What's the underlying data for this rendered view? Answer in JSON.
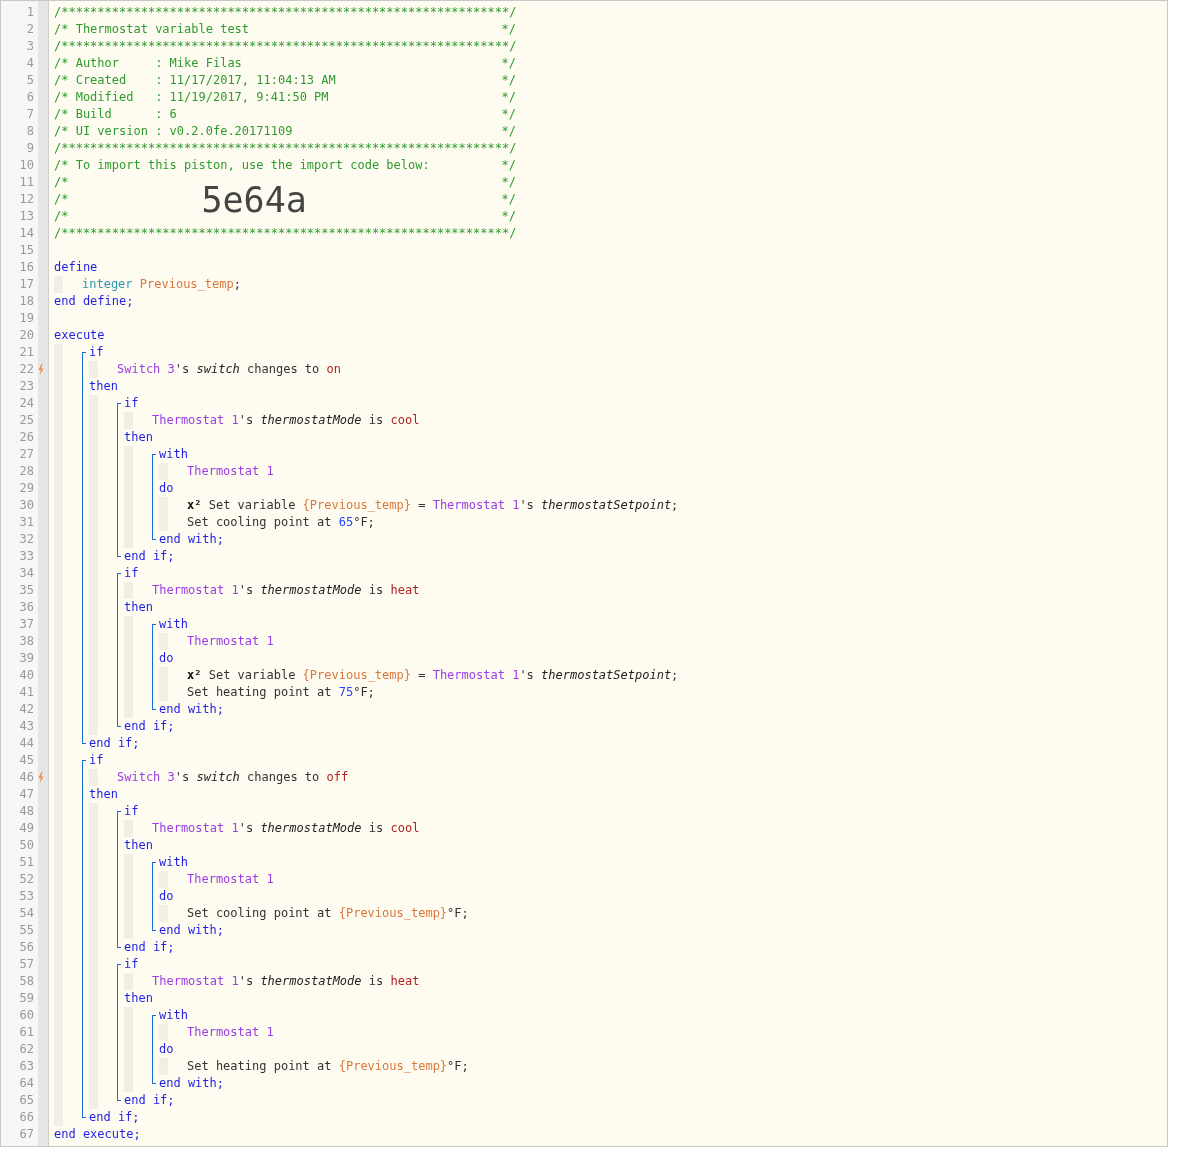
{
  "editor": {
    "lines": [
      {
        "n": "1",
        "trigger": false,
        "segments": [
          {
            "kind": "comment",
            "text": "/**************************************************************/"
          }
        ]
      },
      {
        "n": "2",
        "trigger": false,
        "segments": [
          {
            "kind": "comment",
            "text": "/* Thermostat variable test"
          },
          {
            "kind": "comment_end",
            "text": "*/"
          }
        ]
      },
      {
        "n": "3",
        "trigger": false,
        "segments": [
          {
            "kind": "comment",
            "text": "/**************************************************************/"
          }
        ]
      },
      {
        "n": "4",
        "trigger": false,
        "segments": [
          {
            "kind": "comment",
            "text": "/* Author     : Mike Filas"
          },
          {
            "kind": "comment_end",
            "text": "*/"
          }
        ]
      },
      {
        "n": "5",
        "trigger": false,
        "segments": [
          {
            "kind": "comment",
            "text": "/* Created    : 11/17/2017, 11:04:13 AM"
          },
          {
            "kind": "comment_end",
            "text": "*/"
          }
        ]
      },
      {
        "n": "6",
        "trigger": false,
        "segments": [
          {
            "kind": "comment",
            "text": "/* Modified   : 11/19/2017, 9:41:50 PM"
          },
          {
            "kind": "comment_end",
            "text": "*/"
          }
        ]
      },
      {
        "n": "7",
        "trigger": false,
        "segments": [
          {
            "kind": "comment",
            "text": "/* Build      : 6"
          },
          {
            "kind": "comment_end",
            "text": "*/"
          }
        ]
      },
      {
        "n": "8",
        "trigger": false,
        "segments": [
          {
            "kind": "comment",
            "text": "/* UI version : v0.2.0fe.20171109"
          },
          {
            "kind": "comment_end",
            "text": "*/"
          }
        ]
      },
      {
        "n": "9",
        "trigger": false,
        "segments": [
          {
            "kind": "comment",
            "text": "/**************************************************************/"
          }
        ]
      },
      {
        "n": "10",
        "trigger": false,
        "segments": [
          {
            "kind": "comment",
            "text": "/* To import this piston, use the import code below:"
          },
          {
            "kind": "comment_end",
            "text": "*/"
          }
        ]
      },
      {
        "n": "11",
        "trigger": false,
        "segments": [
          {
            "kind": "comment",
            "text": "/*"
          },
          {
            "kind": "comment_end",
            "text": "*/"
          }
        ]
      },
      {
        "n": "12",
        "trigger": false,
        "segments": [
          {
            "kind": "comment",
            "text": "/*"
          },
          {
            "kind": "import_code",
            "text": "5e64a"
          },
          {
            "kind": "comment_end",
            "text": "*/"
          }
        ]
      },
      {
        "n": "13",
        "trigger": false,
        "segments": [
          {
            "kind": "comment",
            "text": "/*"
          },
          {
            "kind": "comment_end",
            "text": "*/"
          }
        ]
      },
      {
        "n": "14",
        "trigger": false,
        "segments": [
          {
            "kind": "comment",
            "text": "/**************************************************************/"
          }
        ]
      },
      {
        "n": "15",
        "trigger": false
      },
      {
        "n": "16",
        "trigger": false,
        "segments": [
          {
            "kind": "keyword",
            "text": "define"
          }
        ]
      },
      {
        "kind": "indent",
        "children": [
          {
            "n": "17",
            "trigger": false,
            "segments": [
              {
                "kind": "type",
                "text": "integer"
              },
              {
                "kind": "variable",
                "text": "Previous_temp"
              },
              {
                "kind": "plain",
                "text": ";"
              }
            ]
          }
        ]
      },
      {
        "n": "18",
        "trigger": false,
        "segments": [
          {
            "kind": "keyword",
            "text": "end define;"
          }
        ]
      },
      {
        "n": "19",
        "trigger": false
      },
      {
        "n": "20",
        "trigger": false,
        "segments": [
          {
            "kind": "keyword",
            "text": "execute"
          }
        ]
      },
      {
        "kind": "indent",
        "children": [
          {
            "kind": "bracket",
            "children": [
              {
                "n": "21",
                "trigger": false,
                "segments": [
                  {
                    "kind": "keyword",
                    "text": "if"
                  }
                ]
              },
              {
                "kind": "indent",
                "children": [
                  {
                    "n": "22",
                    "trigger": true,
                    "segments": [
                      {
                        "kind": "device",
                        "text": "Switch 3"
                      },
                      {
                        "kind": "plain",
                        "text": "'s "
                      },
                      {
                        "kind": "attribute",
                        "text": "switch"
                      },
                      {
                        "kind": "plain",
                        "text": " changes to "
                      },
                      {
                        "kind": "value",
                        "text": "on"
                      }
                    ]
                  }
                ]
              },
              {
                "n": "23",
                "trigger": false,
                "segments": [
                  {
                    "kind": "keyword",
                    "text": "then"
                  }
                ]
              },
              {
                "kind": "indent",
                "children": [
                  {
                    "kind": "bracket",
                    "children": [
                      {
                        "n": "24",
                        "trigger": false,
                        "segments": [
                          {
                            "kind": "keyword",
                            "text": "if"
                          }
                        ]
                      },
                      {
                        "kind": "indent",
                        "children": [
                          {
                            "n": "25",
                            "trigger": false,
                            "segments": [
                              {
                                "kind": "device",
                                "text": "Thermostat 1"
                              },
                              {
                                "kind": "plain",
                                "text": "'s "
                              },
                              {
                                "kind": "attribute",
                                "text": "thermostatMode"
                              },
                              {
                                "kind": "plain",
                                "text": " is "
                              },
                              {
                                "kind": "value",
                                "text": "cool"
                              }
                            ]
                          }
                        ]
                      },
                      {
                        "n": "26",
                        "trigger": false,
                        "segments": [
                          {
                            "kind": "keyword",
                            "text": "then"
                          }
                        ]
                      },
                      {
                        "kind": "indent",
                        "children": [
                          {
                            "kind": "bracket",
                            "children": [
                              {
                                "n": "27",
                                "trigger": false,
                                "segments": [
                                  {
                                    "kind": "keyword",
                                    "text": "with"
                                  }
                                ]
                              },
                              {
                                "kind": "indent",
                                "children": [
                                  {
                                    "n": "28",
                                    "trigger": false,
                                    "segments": [
                                      {
                                        "kind": "device",
                                        "text": "Thermostat 1"
                                      }
                                    ]
                                  }
                                ]
                              },
                              {
                                "n": "29",
                                "trigger": false,
                                "segments": [
                                  {
                                    "kind": "keyword",
                                    "text": "do"
                                  }
                                ]
                              },
                              {
                                "kind": "indent",
                                "children": [
                                  {
                                    "n": "30",
                                    "trigger": false,
                                    "segments": [
                                      {
                                        "kind": "symbol",
                                        "text": "x²"
                                      },
                                      {
                                        "kind": "plain",
                                        "text": " Set variable "
                                      },
                                      {
                                        "kind": "variable",
                                        "text": "{Previous_temp}"
                                      },
                                      {
                                        "kind": "plain",
                                        "text": " = "
                                      },
                                      {
                                        "kind": "device",
                                        "text": "Thermostat 1"
                                      },
                                      {
                                        "kind": "plain",
                                        "text": "'s "
                                      },
                                      {
                                        "kind": "attribute",
                                        "text": "thermostatSetpoint"
                                      },
                                      {
                                        "kind": "plain",
                                        "text": ";"
                                      }
                                    ]
                                  },
                                  {
                                    "n": "31",
                                    "trigger": false,
                                    "segments": [
                                      {
                                        "kind": "plain",
                                        "text": "Set cooling point at "
                                      },
                                      {
                                        "kind": "number",
                                        "text": "65"
                                      },
                                      {
                                        "kind": "plain",
                                        "text": "°F;"
                                      }
                                    ]
                                  }
                                ]
                              },
                              {
                                "n": "32",
                                "trigger": false,
                                "segments": [
                                  {
                                    "kind": "keyword",
                                    "text": "end with;"
                                  }
                                ]
                              }
                            ]
                          }
                        ]
                      },
                      {
                        "n": "33",
                        "trigger": false,
                        "segments": [
                          {
                            "kind": "keyword",
                            "text": "end if;"
                          }
                        ]
                      }
                    ]
                  },
                  {
                    "kind": "bracket",
                    "children": [
                      {
                        "n": "34",
                        "trigger": false,
                        "segments": [
                          {
                            "kind": "keyword",
                            "text": "if"
                          }
                        ]
                      },
                      {
                        "kind": "indent",
                        "children": [
                          {
                            "n": "35",
                            "trigger": false,
                            "segments": [
                              {
                                "kind": "device",
                                "text": "Thermostat 1"
                              },
                              {
                                "kind": "plain",
                                "text": "'s "
                              },
                              {
                                "kind": "attribute",
                                "text": "thermostatMode"
                              },
                              {
                                "kind": "plain",
                                "text": " is "
                              },
                              {
                                "kind": "value",
                                "text": "heat"
                              }
                            ]
                          }
                        ]
                      },
                      {
                        "n": "36",
                        "trigger": false,
                        "segments": [
                          {
                            "kind": "keyword",
                            "text": "then"
                          }
                        ]
                      },
                      {
                        "kind": "indent",
                        "children": [
                          {
                            "kind": "bracket",
                            "children": [
                              {
                                "n": "37",
                                "trigger": false,
                                "segments": [
                                  {
                                    "kind": "keyword",
                                    "text": "with"
                                  }
                                ]
                              },
                              {
                                "kind": "indent",
                                "children": [
                                  {
                                    "n": "38",
                                    "trigger": false,
                                    "segments": [
                                      {
                                        "kind": "device",
                                        "text": "Thermostat 1"
                                      }
                                    ]
                                  }
                                ]
                              },
                              {
                                "n": "39",
                                "trigger": false,
                                "segments": [
                                  {
                                    "kind": "keyword",
                                    "text": "do"
                                  }
                                ]
                              },
                              {
                                "kind": "indent",
                                "children": [
                                  {
                                    "n": "40",
                                    "trigger": false,
                                    "segments": [
                                      {
                                        "kind": "symbol",
                                        "text": "x²"
                                      },
                                      {
                                        "kind": "plain",
                                        "text": " Set variable "
                                      },
                                      {
                                        "kind": "variable",
                                        "text": "{Previous_temp}"
                                      },
                                      {
                                        "kind": "plain",
                                        "text": " = "
                                      },
                                      {
                                        "kind": "device",
                                        "text": "Thermostat 1"
                                      },
                                      {
                                        "kind": "plain",
                                        "text": "'s "
                                      },
                                      {
                                        "kind": "attribute",
                                        "text": "thermostatSetpoint"
                                      },
                                      {
                                        "kind": "plain",
                                        "text": ";"
                                      }
                                    ]
                                  },
                                  {
                                    "n": "41",
                                    "trigger": false,
                                    "segments": [
                                      {
                                        "kind": "plain",
                                        "text": "Set heating point at "
                                      },
                                      {
                                        "kind": "number",
                                        "text": "75"
                                      },
                                      {
                                        "kind": "plain",
                                        "text": "°F;"
                                      }
                                    ]
                                  }
                                ]
                              },
                              {
                                "n": "42",
                                "trigger": false,
                                "segments": [
                                  {
                                    "kind": "keyword",
                                    "text": "end with;"
                                  }
                                ]
                              }
                            ]
                          }
                        ]
                      },
                      {
                        "n": "43",
                        "trigger": false,
                        "segments": [
                          {
                            "kind": "keyword",
                            "text": "end if;"
                          }
                        ]
                      }
                    ]
                  }
                ]
              },
              {
                "n": "44",
                "trigger": false,
                "segments": [
                  {
                    "kind": "keyword",
                    "text": "end if;"
                  }
                ]
              }
            ]
          },
          {
            "kind": "bracket",
            "children": [
              {
                "n": "45",
                "trigger": false,
                "segments": [
                  {
                    "kind": "keyword",
                    "text": "if"
                  }
                ]
              },
              {
                "kind": "indent",
                "children": [
                  {
                    "n": "46",
                    "trigger": true,
                    "segments": [
                      {
                        "kind": "device",
                        "text": "Switch 3"
                      },
                      {
                        "kind": "plain",
                        "text": "'s "
                      },
                      {
                        "kind": "attribute",
                        "text": "switch"
                      },
                      {
                        "kind": "plain",
                        "text": " changes to "
                      },
                      {
                        "kind": "value",
                        "text": "off"
                      }
                    ]
                  }
                ]
              },
              {
                "n": "47",
                "trigger": false,
                "segments": [
                  {
                    "kind": "keyword",
                    "text": "then"
                  }
                ]
              },
              {
                "kind": "indent",
                "children": [
                  {
                    "kind": "bracket",
                    "children": [
                      {
                        "n": "48",
                        "trigger": false,
                        "segments": [
                          {
                            "kind": "keyword",
                            "text": "if"
                          }
                        ]
                      },
                      {
                        "kind": "indent",
                        "children": [
                          {
                            "n": "49",
                            "trigger": false,
                            "segments": [
                              {
                                "kind": "device",
                                "text": "Thermostat 1"
                              },
                              {
                                "kind": "plain",
                                "text": "'s "
                              },
                              {
                                "kind": "attribute",
                                "text": "thermostatMode"
                              },
                              {
                                "kind": "plain",
                                "text": " is "
                              },
                              {
                                "kind": "value",
                                "text": "cool"
                              }
                            ]
                          }
                        ]
                      },
                      {
                        "n": "50",
                        "trigger": false,
                        "segments": [
                          {
                            "kind": "keyword",
                            "text": "then"
                          }
                        ]
                      },
                      {
                        "kind": "indent",
                        "children": [
                          {
                            "kind": "bracket",
                            "children": [
                              {
                                "n": "51",
                                "trigger": false,
                                "segments": [
                                  {
                                    "kind": "keyword",
                                    "text": "with"
                                  }
                                ]
                              },
                              {
                                "kind": "indent",
                                "children": [
                                  {
                                    "n": "52",
                                    "trigger": false,
                                    "segments": [
                                      {
                                        "kind": "device",
                                        "text": "Thermostat 1"
                                      }
                                    ]
                                  }
                                ]
                              },
                              {
                                "n": "53",
                                "trigger": false,
                                "segments": [
                                  {
                                    "kind": "keyword",
                                    "text": "do"
                                  }
                                ]
                              },
                              {
                                "kind": "indent",
                                "children": [
                                  {
                                    "n": "54",
                                    "trigger": false,
                                    "segments": [
                                      {
                                        "kind": "plain",
                                        "text": "Set cooling point at "
                                      },
                                      {
                                        "kind": "variable",
                                        "text": "{Previous_temp}"
                                      },
                                      {
                                        "kind": "plain",
                                        "text": "°F;"
                                      }
                                    ]
                                  }
                                ]
                              },
                              {
                                "n": "55",
                                "trigger": false,
                                "segments": [
                                  {
                                    "kind": "keyword",
                                    "text": "end with;"
                                  }
                                ]
                              }
                            ]
                          }
                        ]
                      },
                      {
                        "n": "56",
                        "trigger": false,
                        "segments": [
                          {
                            "kind": "keyword",
                            "text": "end if;"
                          }
                        ]
                      }
                    ]
                  },
                  {
                    "kind": "bracket",
                    "children": [
                      {
                        "n": "57",
                        "trigger": false,
                        "segments": [
                          {
                            "kind": "keyword",
                            "text": "if"
                          }
                        ]
                      },
                      {
                        "kind": "indent",
                        "children": [
                          {
                            "n": "58",
                            "trigger": false,
                            "segments": [
                              {
                                "kind": "device",
                                "text": "Thermostat 1"
                              },
                              {
                                "kind": "plain",
                                "text": "'s "
                              },
                              {
                                "kind": "attribute",
                                "text": "thermostatMode"
                              },
                              {
                                "kind": "plain",
                                "text": " is "
                              },
                              {
                                "kind": "value",
                                "text": "heat"
                              }
                            ]
                          }
                        ]
                      },
                      {
                        "n": "59",
                        "trigger": false,
                        "segments": [
                          {
                            "kind": "keyword",
                            "text": "then"
                          }
                        ]
                      },
                      {
                        "kind": "indent",
                        "children": [
                          {
                            "kind": "bracket",
                            "children": [
                              {
                                "n": "60",
                                "trigger": false,
                                "segments": [
                                  {
                                    "kind": "keyword",
                                    "text": "with"
                                  }
                                ]
                              },
                              {
                                "kind": "indent",
                                "children": [
                                  {
                                    "n": "61",
                                    "trigger": false,
                                    "segments": [
                                      {
                                        "kind": "device",
                                        "text": "Thermostat 1"
                                      }
                                    ]
                                  }
                                ]
                              },
                              {
                                "n": "62",
                                "trigger": false,
                                "segments": [
                                  {
                                    "kind": "keyword",
                                    "text": "do"
                                  }
                                ]
                              },
                              {
                                "kind": "indent",
                                "children": [
                                  {
                                    "n": "63",
                                    "trigger": false,
                                    "segments": [
                                      {
                                        "kind": "plain",
                                        "text": "Set heating point at "
                                      },
                                      {
                                        "kind": "variable",
                                        "text": "{Previous_temp}"
                                      },
                                      {
                                        "kind": "plain",
                                        "text": "°F;"
                                      }
                                    ]
                                  }
                                ]
                              },
                              {
                                "n": "64",
                                "trigger": false,
                                "segments": [
                                  {
                                    "kind": "keyword",
                                    "text": "end with;"
                                  }
                                ]
                              }
                            ]
                          }
                        ]
                      },
                      {
                        "n": "65",
                        "trigger": false,
                        "segments": [
                          {
                            "kind": "keyword",
                            "text": "end if;"
                          }
                        ]
                      }
                    ]
                  }
                ]
              },
              {
                "n": "66",
                "trigger": false,
                "segments": [
                  {
                    "kind": "keyword",
                    "text": "end if;"
                  }
                ]
              }
            ]
          }
        ]
      },
      {
        "n": "67",
        "trigger": false,
        "segments": [
          {
            "kind": "keyword",
            "text": "end execute;"
          }
        ]
      }
    ]
  }
}
